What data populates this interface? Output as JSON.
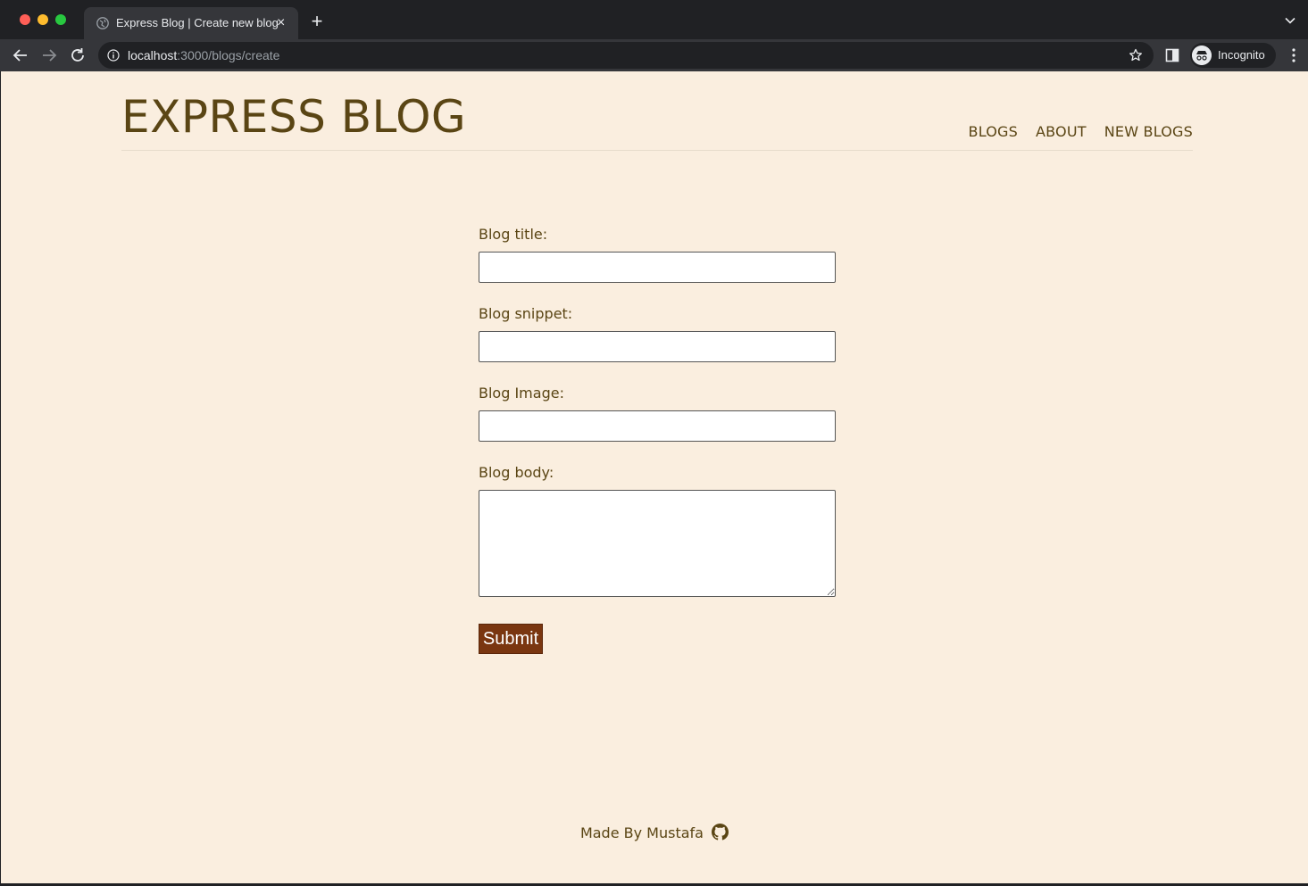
{
  "browser": {
    "tab_title": "Express Blog | Create new blog",
    "tab_close": "×",
    "new_tab": "+",
    "url_host": "localhost",
    "url_path": ":3000/blogs/create",
    "profile_label": "Incognito"
  },
  "site": {
    "title": "EXPRESS BLOG",
    "nav": [
      "BLOGS",
      "ABOUT",
      "NEW BLOGS"
    ]
  },
  "form": {
    "title_label": "Blog title:",
    "title_value": "",
    "snippet_label": "Blog snippet:",
    "snippet_value": "",
    "image_label": "Blog Image:",
    "image_value": "",
    "body_label": "Blog body:",
    "body_value": "",
    "submit_label": "Submit"
  },
  "footer": {
    "text": "Made By Mustafa",
    "icon": "github-icon"
  },
  "colors": {
    "page_bg": "#faeedf",
    "text_brown": "#5a4514",
    "button_bg": "#7a3610"
  }
}
